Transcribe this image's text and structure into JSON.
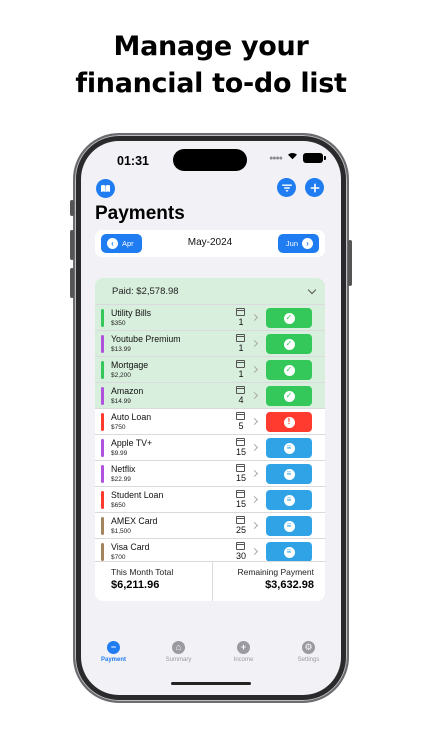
{
  "headline": {
    "line1": "Manage your",
    "line2": "financial to-do list"
  },
  "status_bar": {
    "time": "01:31"
  },
  "header": {
    "title": "Payments",
    "icons": [
      "book-icon",
      "filter-icon",
      "plus-icon"
    ]
  },
  "month_nav": {
    "prev_label": "Apr",
    "current": "May-2024",
    "next_label": "Jun"
  },
  "paid_section": {
    "label": "Paid: $2,578.98"
  },
  "payments": [
    {
      "name": "Utility Bills",
      "amount": "$350",
      "count": "1",
      "status": "paid",
      "color": "#34c759"
    },
    {
      "name": "Youtube Premium",
      "amount": "$13.99",
      "count": "1",
      "status": "paid",
      "color": "#af52de"
    },
    {
      "name": "Mortgage",
      "amount": "$2,200",
      "count": "1",
      "status": "paid",
      "color": "#34c759"
    },
    {
      "name": "Amazon",
      "amount": "$14.99",
      "count": "4",
      "status": "paid",
      "color": "#af52de"
    },
    {
      "name": "Auto Loan",
      "amount": "$750",
      "count": "5",
      "status": "overdue",
      "color": "#ff3b30"
    },
    {
      "name": "Apple TV+",
      "amount": "$9.99",
      "count": "15",
      "status": "pending",
      "color": "#af52de"
    },
    {
      "name": "Netflix",
      "amount": "$22.99",
      "count": "15",
      "status": "pending",
      "color": "#af52de"
    },
    {
      "name": "Student Loan",
      "amount": "$650",
      "count": "15",
      "status": "pending",
      "color": "#ff3b30"
    },
    {
      "name": "AMEX Card",
      "amount": "$1,500",
      "count": "25",
      "status": "pending",
      "color": "#a2845e"
    },
    {
      "name": "Visa Card",
      "amount": "$700",
      "count": "30",
      "status": "pending",
      "color": "#a2845e"
    }
  ],
  "totals": {
    "month_label": "This Month Total",
    "month_value": "$6,211.96",
    "remaining_label": "Remaining Payment",
    "remaining_value": "$3,632.98"
  },
  "tabs": [
    {
      "label": "Payment",
      "icon": "minus-circle-icon",
      "active": true
    },
    {
      "label": "Summary",
      "icon": "home-icon",
      "active": false
    },
    {
      "label": "Income",
      "icon": "plus-circle-icon",
      "active": false
    },
    {
      "label": "Settings",
      "icon": "gear-icon",
      "active": false
    }
  ],
  "colors": {
    "accent": "#1f7cf1",
    "paid": "#34c759",
    "overdue": "#ff3b30",
    "pending": "#30a3e6",
    "paid_bg": "#d8efdd"
  }
}
